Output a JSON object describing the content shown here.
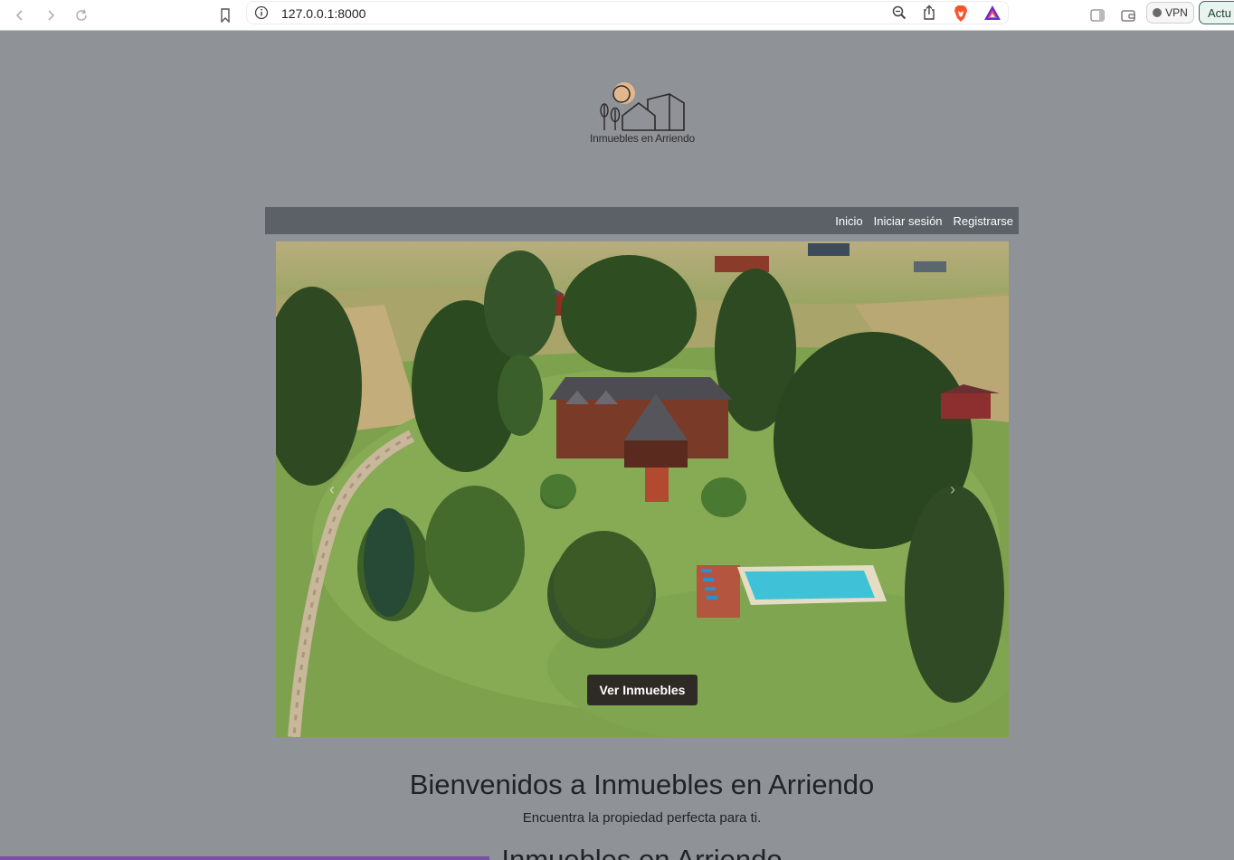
{
  "browser": {
    "url": "127.0.0.1:8000",
    "vpn_label": "VPN",
    "update_label": "Actu",
    "icons": [
      "back-icon",
      "forward-icon",
      "reload-icon",
      "bookmark-icon",
      "info-icon",
      "zoom-icon",
      "share-icon",
      "brave-shield-icon",
      "brave-rewards-icon",
      "sidebar-icon",
      "wallet-icon"
    ]
  },
  "header": {
    "logo_text": "Inmuebles en Arriendo"
  },
  "nav": {
    "items": [
      {
        "label": "Inicio"
      },
      {
        "label": "Iniciar sesión"
      },
      {
        "label": "Registrarse"
      }
    ]
  },
  "hero": {
    "cta_label": "Ver Inmuebles",
    "prev_label": "‹",
    "next_label": "›"
  },
  "welcome": {
    "title": "Bienvenidos a Inmuebles en Arriendo",
    "subtitle": "Encuentra la propiedad perfecta para ti.",
    "next_heading": "Inmuebles en Arriendo"
  },
  "colors": {
    "page_bg": "#8f9296",
    "navbar_bg": "#5b6167",
    "cta_bg": "#2e2b27",
    "logo_sun": "#e2b78d"
  }
}
